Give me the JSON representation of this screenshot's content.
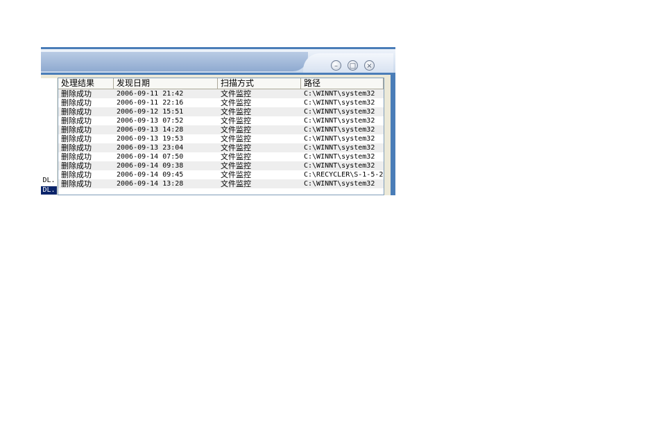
{
  "window_controls": {
    "minimize": "–",
    "maximize": "□",
    "close": "×"
  },
  "side_labels": [
    "DL.",
    "DL."
  ],
  "table": {
    "columns": [
      "处理结果",
      "发现日期",
      "扫描方式",
      "路径"
    ],
    "rows": [
      [
        "删除成功",
        "2006-09-11 21:42",
        "文件监控",
        "C:\\WINNT\\system32"
      ],
      [
        "删除成功",
        "2006-09-11 22:16",
        "文件监控",
        "C:\\WINNT\\system32"
      ],
      [
        "删除成功",
        "2006-09-12 15:51",
        "文件监控",
        "C:\\WINNT\\system32"
      ],
      [
        "删除成功",
        "2006-09-13 07:52",
        "文件监控",
        "C:\\WINNT\\system32"
      ],
      [
        "删除成功",
        "2006-09-13 14:28",
        "文件监控",
        "C:\\WINNT\\system32"
      ],
      [
        "删除成功",
        "2006-09-13 19:53",
        "文件监控",
        "C:\\WINNT\\system32"
      ],
      [
        "删除成功",
        "2006-09-13 23:04",
        "文件监控",
        "C:\\WINNT\\system32"
      ],
      [
        "删除成功",
        "2006-09-14 07:50",
        "文件监控",
        "C:\\WINNT\\system32"
      ],
      [
        "删除成功",
        "2006-09-14 09:38",
        "文件监控",
        "C:\\WINNT\\system32"
      ],
      [
        "删除成功",
        "2006-09-14 09:45",
        "文件监控",
        "C:\\RECYCLER\\S-1-5-2"
      ],
      [
        "删除成功",
        "2006-09-14 13:28",
        "文件监控",
        "C:\\WINNT\\system32"
      ]
    ]
  }
}
